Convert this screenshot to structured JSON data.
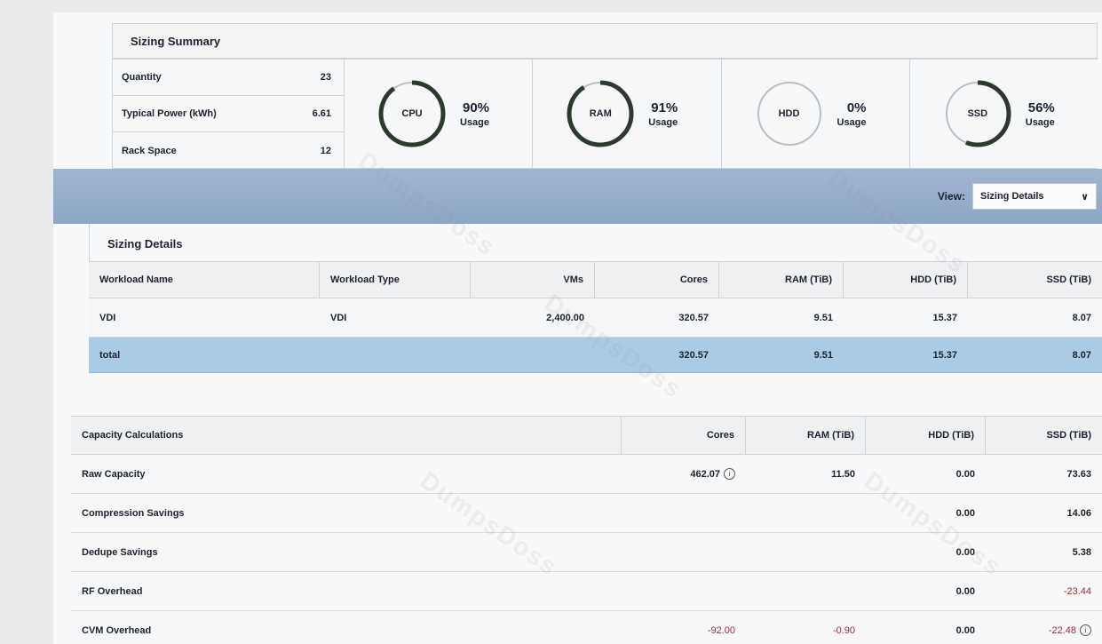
{
  "summary": {
    "title": "Sizing Summary",
    "stats": [
      {
        "label": "Quantity",
        "value": "23"
      },
      {
        "label": "Typical Power (kWh)",
        "value": "6.61"
      },
      {
        "label": "Rack Space",
        "value": "12"
      }
    ],
    "gauges": [
      {
        "name": "CPU",
        "percent": "90%",
        "usage": "Usage",
        "fraction": 0.9
      },
      {
        "name": "RAM",
        "percent": "91%",
        "usage": "Usage",
        "fraction": 0.91
      },
      {
        "name": "HDD",
        "percent": "0%",
        "usage": "Usage",
        "fraction": 0.0
      },
      {
        "name": "SSD",
        "percent": "56%",
        "usage": "Usage",
        "fraction": 0.56
      }
    ]
  },
  "view": {
    "label": "View:",
    "selected": "Sizing Details"
  },
  "details": {
    "title": "Sizing Details",
    "columns": [
      "Workload Name",
      "Workload Type",
      "VMs",
      "Cores",
      "RAM (TiB)",
      "HDD (TiB)",
      "SSD (TiB)"
    ],
    "rows": [
      [
        "VDI",
        "VDI",
        "2,400.00",
        "320.57",
        "9.51",
        "15.37",
        "8.07"
      ]
    ],
    "total": [
      "total",
      "",
      "",
      "320.57",
      "9.51",
      "15.37",
      "8.07"
    ]
  },
  "capacity": {
    "columns": [
      "Capacity Calculations",
      "Cores",
      "RAM (TiB)",
      "HDD (TiB)",
      "SSD (TiB)"
    ],
    "rows": [
      {
        "label": "Raw Capacity",
        "cores": "462.07",
        "ram": "11.50",
        "hdd": "0.00",
        "ssd": "73.63"
      },
      {
        "label": "Compression Savings",
        "cores": "",
        "ram": "",
        "hdd": "0.00",
        "ssd": "14.06"
      },
      {
        "label": "Dedupe Savings",
        "cores": "",
        "ram": "",
        "hdd": "0.00",
        "ssd": "5.38"
      },
      {
        "label": "RF Overhead",
        "cores": "",
        "ram": "",
        "hdd": "0.00",
        "ssd": "-23.44"
      },
      {
        "label": "CVM Overhead",
        "cores": "-92.00",
        "ram": "-0.90",
        "hdd": "0.00",
        "ssd": "-22.48"
      }
    ]
  },
  "watermark": "DumpsDoss",
  "colors": {
    "ring": "#2c3a2e",
    "band": "#8ea6c6",
    "total_row": "#a9cbe6",
    "negative": "#9e2a35"
  }
}
